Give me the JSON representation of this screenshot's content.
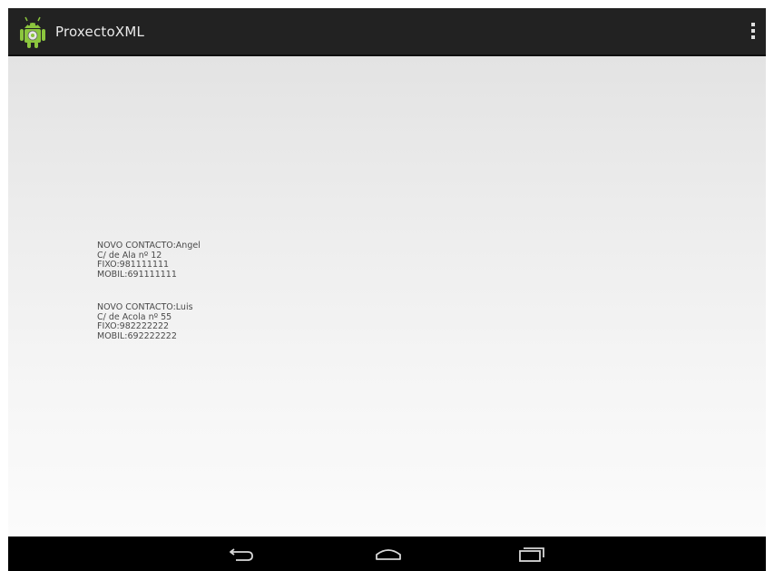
{
  "action_bar": {
    "title": "ProxectoXML",
    "app_icon": "android-robot-icon",
    "menu_icon": "overflow-menu-icon",
    "background_color": "#222222"
  },
  "contacts": [
    {
      "header": "NOVO CONTACTO:Angel",
      "address": "C/ de Ala nº 12",
      "fixo": "FIXO:981111111",
      "mobil": "MOBIL:691111111"
    },
    {
      "header": "NOVO CONTACTO:Luis",
      "address": "C/ de Acola nº 55",
      "fixo": "FIXO:982222222",
      "mobil": "MOBIL:692222222"
    }
  ],
  "navigation_bar": {
    "buttons": [
      "back-icon",
      "home-icon",
      "recent-apps-icon"
    ],
    "background_color": "#000000"
  }
}
